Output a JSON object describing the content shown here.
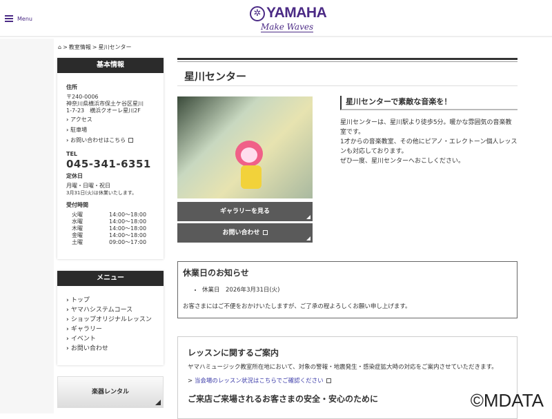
{
  "header": {
    "menu_label": "Menu",
    "logo_text": "YAMAHA",
    "logo_tagline": "Make Waves"
  },
  "breadcrumb": {
    "items": [
      "教室情報",
      "星川センター"
    ],
    "sep": ">"
  },
  "basic_info": {
    "heading": "基本情報",
    "address_label": "住所",
    "postal": "〒240-0006",
    "address1": "神奈川県横浜市保土ケ谷区星川",
    "address2": "1-7-23　横浜クオーレ星川2F",
    "links": [
      "アクセス",
      "駐車場",
      "お問い合わせはこちら"
    ],
    "tel_label": "TEL",
    "tel": "045-341-6351",
    "closed_label": "定休日",
    "closed": "月曜・日曜・祝日",
    "closed_note": "3月31日(火)は休業いたします。",
    "hours_label": "受付時間",
    "hours": [
      {
        "day": "火曜",
        "time": "14:00〜18:00"
      },
      {
        "day": "水曜",
        "time": "14:00〜18:00"
      },
      {
        "day": "木曜",
        "time": "14:00〜18:00"
      },
      {
        "day": "金曜",
        "time": "14:00〜18:00"
      },
      {
        "day": "土曜",
        "time": "09:00〜17:00"
      }
    ]
  },
  "menu": {
    "heading": "メニュー",
    "items": [
      "トップ",
      "ヤマハシステムコース",
      "ショップオリジナルレッスン",
      "ギャラリー",
      "イベント",
      "お問い合わせ"
    ]
  },
  "rental": {
    "label": "楽器レンタル"
  },
  "main": {
    "title": "星川センター",
    "gallery_button": "ギャラリーを見る",
    "contact_button": "お問い合わせ",
    "intro_heading": "星川センターで素敵な音楽を！",
    "intro_lines": [
      "星川センターは、星川駅より徒歩5分。暖かな雰囲気の音楽教室です。",
      "1才からの音楽教室、その他にピアノ・エレクトーン個人レッスンも対応しております。",
      "ぜひ一度、星川センターへおこしください。"
    ]
  },
  "notice": {
    "heading": "休業日のお知らせ",
    "item": "休業日　2026年3月31日(火)",
    "text": "お客さまにはご不便をおかけいたしますが、ご了承の程よろしくお願い申し上げます。"
  },
  "lesson": {
    "heading": "レッスンに関するご案内",
    "text": "ヤマハミュージック教室所在地において、対象の警報・地震発生・感染症拡大時の対応をご案内させていただきます。",
    "link": "当会場のレッスン状況はこちらでご確認ください",
    "subheading": "ご来店ご来場されるお客さまの安全・安心のために"
  },
  "watermark": "©MDATA"
}
